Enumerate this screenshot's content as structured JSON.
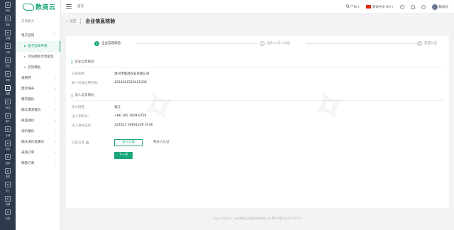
{
  "rail": {
    "items": [
      {
        "label": "首页"
      },
      {
        "label": "商品"
      },
      {
        "label": "店铺"
      },
      {
        "label": "订单"
      },
      {
        "label": "供应"
      },
      {
        "label": "采购"
      },
      {
        "label": "交易"
      },
      {
        "label": "物流"
      },
      {
        "label": "客户"
      },
      {
        "label": "仓储"
      },
      {
        "label": "财务"
      },
      {
        "label": "结算"
      },
      {
        "label": "报表"
      },
      {
        "label": "员工"
      },
      {
        "label": "设置"
      },
      {
        "label": "系统"
      }
    ]
  },
  "menu": {
    "logo_text": "数商云",
    "header": "交易能力",
    "items": [
      {
        "label": "电子合同",
        "type": "group",
        "arrow": "^"
      },
      {
        "label": "电子签章申请",
        "type": "sub",
        "active": true
      },
      {
        "label": "合同模板市场套装",
        "type": "sub"
      },
      {
        "label": "合同模板",
        "type": "sub"
      },
      {
        "label": "进销存",
        "type": "item",
        "arrow": ">"
      },
      {
        "label": "需求发布",
        "type": "item",
        "arrow": ">"
      },
      {
        "label": "需求报价",
        "type": "item",
        "arrow": ">"
      },
      {
        "label": "确认需求报价",
        "type": "item",
        "arrow": ">"
      },
      {
        "label": "商品询价",
        "type": "item",
        "arrow": ">"
      },
      {
        "label": "询价报价",
        "type": "item",
        "arrow": ">"
      },
      {
        "label": "确认询价选报价",
        "type": "item",
        "arrow": ">"
      },
      {
        "label": "采购订单",
        "type": "item",
        "arrow": ">"
      },
      {
        "label": "销售订单",
        "type": "item",
        "arrow": ">"
      }
    ]
  },
  "topbar": {
    "home": "首页",
    "location": "广州",
    "language": "简体中文-ZH",
    "user_name": "数商云"
  },
  "page": {
    "back": "返回",
    "title": "企业信息核验"
  },
  "steps": [
    {
      "num": "1",
      "label": "企业信息核验",
      "active": true
    },
    {
      "num": "2",
      "label": "经办人/法人认证",
      "active": false
    },
    {
      "num": "3",
      "label": "完成认证",
      "active": false
    }
  ],
  "company": {
    "section_title": "企业信息核验",
    "name_label": "公司名称:",
    "name_value": "温州市隆昌农业有限公司",
    "code_label": "统一社会信用代码:",
    "code_value": "4324324325425435"
  },
  "legal": {
    "section_title": "法人信息核验",
    "name_label": "法人姓名:",
    "name_value": "张三",
    "phone_label": "法人手机号:",
    "phone_value": "+86 185 2929 6758",
    "id_label": "法人身份证号:",
    "id_value": "321023 19891206 3746"
  },
  "auth": {
    "label": "认证方式",
    "options": [
      {
        "label": "法人认证",
        "selected": true
      },
      {
        "label": "经办人认证",
        "selected": false
      }
    ]
  },
  "next_button": "下一步",
  "footer": "Copy Right©广州市数商云网络科技有限公司 粤ICP备18044797号-5",
  "colors": {
    "accent": "#19a67a",
    "rail_bg": "#2d3a4b"
  }
}
